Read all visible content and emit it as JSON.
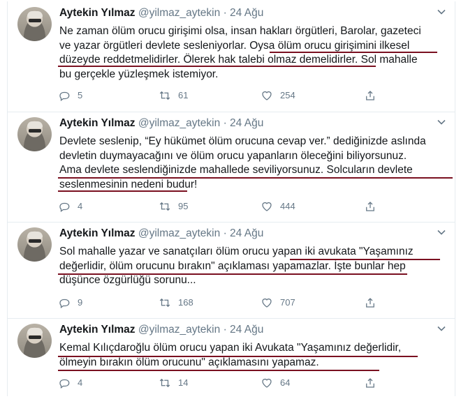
{
  "tweets": [
    {
      "name": "Aytekin Yılmaz",
      "handle": "@yilmaz_aytekin",
      "separator": "·",
      "date": "24 Ağu",
      "text": "Ne zaman ölüm orucu girişimi olsa, insan hakları örgütleri, Barolar, gazeteci\nve yazar örgütleri devlete sesleniyorlar. Oysa ölüm orucu girişimini ilkesel\ndüzeyde reddetmelidirler. Ölerek hak talebi olmaz demelidirler. Sol mahalle\nbu gerçekle yüzleşmek istemiyor.",
      "replies": "5",
      "retweets": "61",
      "likes": "254"
    },
    {
      "name": "Aytekin Yılmaz",
      "handle": "@yilmaz_aytekin",
      "separator": "·",
      "date": "24 Ağu",
      "text": "Devlete seslenip, “Ey hükümet ölüm orucuna cevap ver.” dediğinizde aslında\ndevletin duymayacağını ve ölüm orucu yapanların öleceğini biliyorsunuz.\nAma devlete seslendiğinizde mahallede seviliyorsunuz. Solcuların devlete\nseslenmesinin nedeni budur!",
      "replies": "4",
      "retweets": "95",
      "likes": "444"
    },
    {
      "name": "Aytekin Yılmaz",
      "handle": "@yilmaz_aytekin",
      "separator": "·",
      "date": "24 Ağu",
      "text": "Sol mahalle yazar ve sanatçıları ölüm orucu yapan iki avukata \"Yaşamınız\ndeğerlidir, ölüm orucunu bırakın\" açıklaması yapamazlar. İşte bunlar hep\ndüşünce özgürlüğü sorunu...",
      "replies": "9",
      "retweets": "168",
      "likes": "707"
    },
    {
      "name": "Aytekin Yılmaz",
      "handle": "@yilmaz_aytekin",
      "separator": "·",
      "date": "24 Ağu",
      "text": "Kemal Kılıçdaroğlu ölüm orucu yapan iki Avukata \"Yaşamınız değerlidir,\nölmeyin bırakın ölüm orucunu\" açıklamasını yapamaz.",
      "replies": "4",
      "retweets": "14",
      "likes": "64"
    }
  ],
  "icons": {
    "reply": "reply-icon",
    "retweet": "retweet-icon",
    "like": "heart-icon",
    "share": "share-icon",
    "menu": "chevron-down-icon"
  },
  "colors": {
    "text": "#14171a",
    "secondary": "#657786",
    "divider": "#e6ecf0",
    "underline": "#7a1020"
  }
}
